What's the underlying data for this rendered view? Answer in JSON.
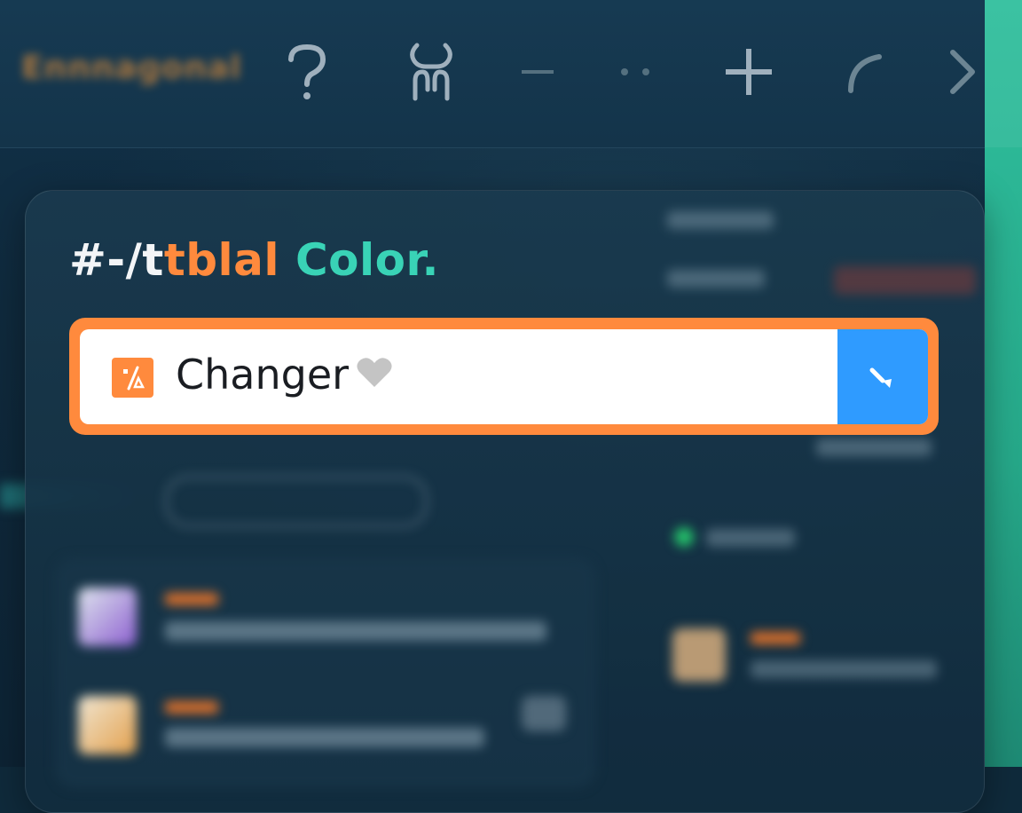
{
  "panel": {
    "title_part1": "#-/t",
    "title_part2": "tblal",
    "title_part3": "Color."
  },
  "field": {
    "icon_glyph": "⁄₀",
    "value": "Changer",
    "heart_glyph": "♥"
  },
  "toolbar": {
    "brand_text": "Ennnaɡonal"
  },
  "icons": [
    "question-icon",
    "users-icon",
    "minus-icon",
    "more-icon",
    "plus-icon",
    "arc-icon",
    "chevron-right-icon",
    "pencil-icon",
    "heart-icon",
    "percent-icon"
  ],
  "colors": {
    "accent_orange": "#ff8a3d",
    "accent_teal": "#39d3b6",
    "button_blue": "#2f9bff",
    "right_strip": "#2fbf9d",
    "background": "#0f2a3b"
  }
}
